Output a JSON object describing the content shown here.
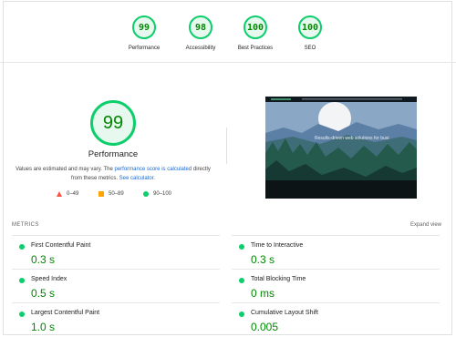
{
  "top_scores": [
    {
      "score": "99",
      "label": "Performance"
    },
    {
      "score": "98",
      "label": "Accessibility"
    },
    {
      "score": "100",
      "label": "Best Practices"
    },
    {
      "score": "100",
      "label": "SEO"
    }
  ],
  "performance": {
    "score": "99",
    "title": "Performance",
    "desc_pre": "Values are estimated and may vary. The ",
    "desc_link1": "performance score is calculated",
    "desc_mid": " directly from these metrics. ",
    "desc_link2": "See calculator."
  },
  "legend": {
    "fail": "0–49",
    "average": "50–89",
    "pass": "90–100"
  },
  "screenshot": {
    "headline": "Results-driven web solutions for busi"
  },
  "metrics_header": "METRICS",
  "expand_label": "Expand view",
  "metrics": [
    {
      "name": "First Contentful Paint",
      "value": "0.3 s"
    },
    {
      "name": "Time to Interactive",
      "value": "0.3 s"
    },
    {
      "name": "Speed Index",
      "value": "0.5 s"
    },
    {
      "name": "Total Blocking Time",
      "value": "0 ms"
    },
    {
      "name": "Largest Contentful Paint",
      "value": "1.0 s"
    },
    {
      "name": "Cumulative Layout Shift",
      "value": "0.005"
    }
  ],
  "colors": {
    "pass": "#0cce6b",
    "pass_text": "#008800",
    "average": "#ffa400",
    "fail": "#ff4e42",
    "link": "#1967d2"
  }
}
